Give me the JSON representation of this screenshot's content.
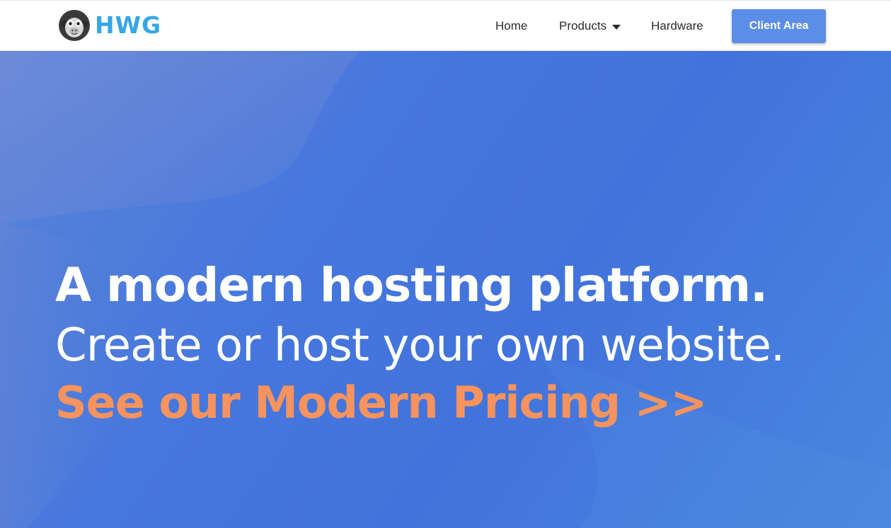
{
  "header": {
    "logo_text": "HWG",
    "nav": {
      "home": "Home",
      "products": "Products",
      "hardware": "Hardware"
    },
    "client_area": "Client Area"
  },
  "hero": {
    "headline": "A modern hosting platform.",
    "subheadline": "Create or host your own website.",
    "cta": "See our Modern Pricing >>"
  },
  "icons": {
    "logo": "gorilla-mascot-icon",
    "products_dropdown": "caret-down-icon"
  },
  "colors": {
    "brand_text": "#36a7e8",
    "client_button": "#5b8ee6",
    "hero_background": "#4676dc",
    "cta_text": "#f7935e"
  }
}
